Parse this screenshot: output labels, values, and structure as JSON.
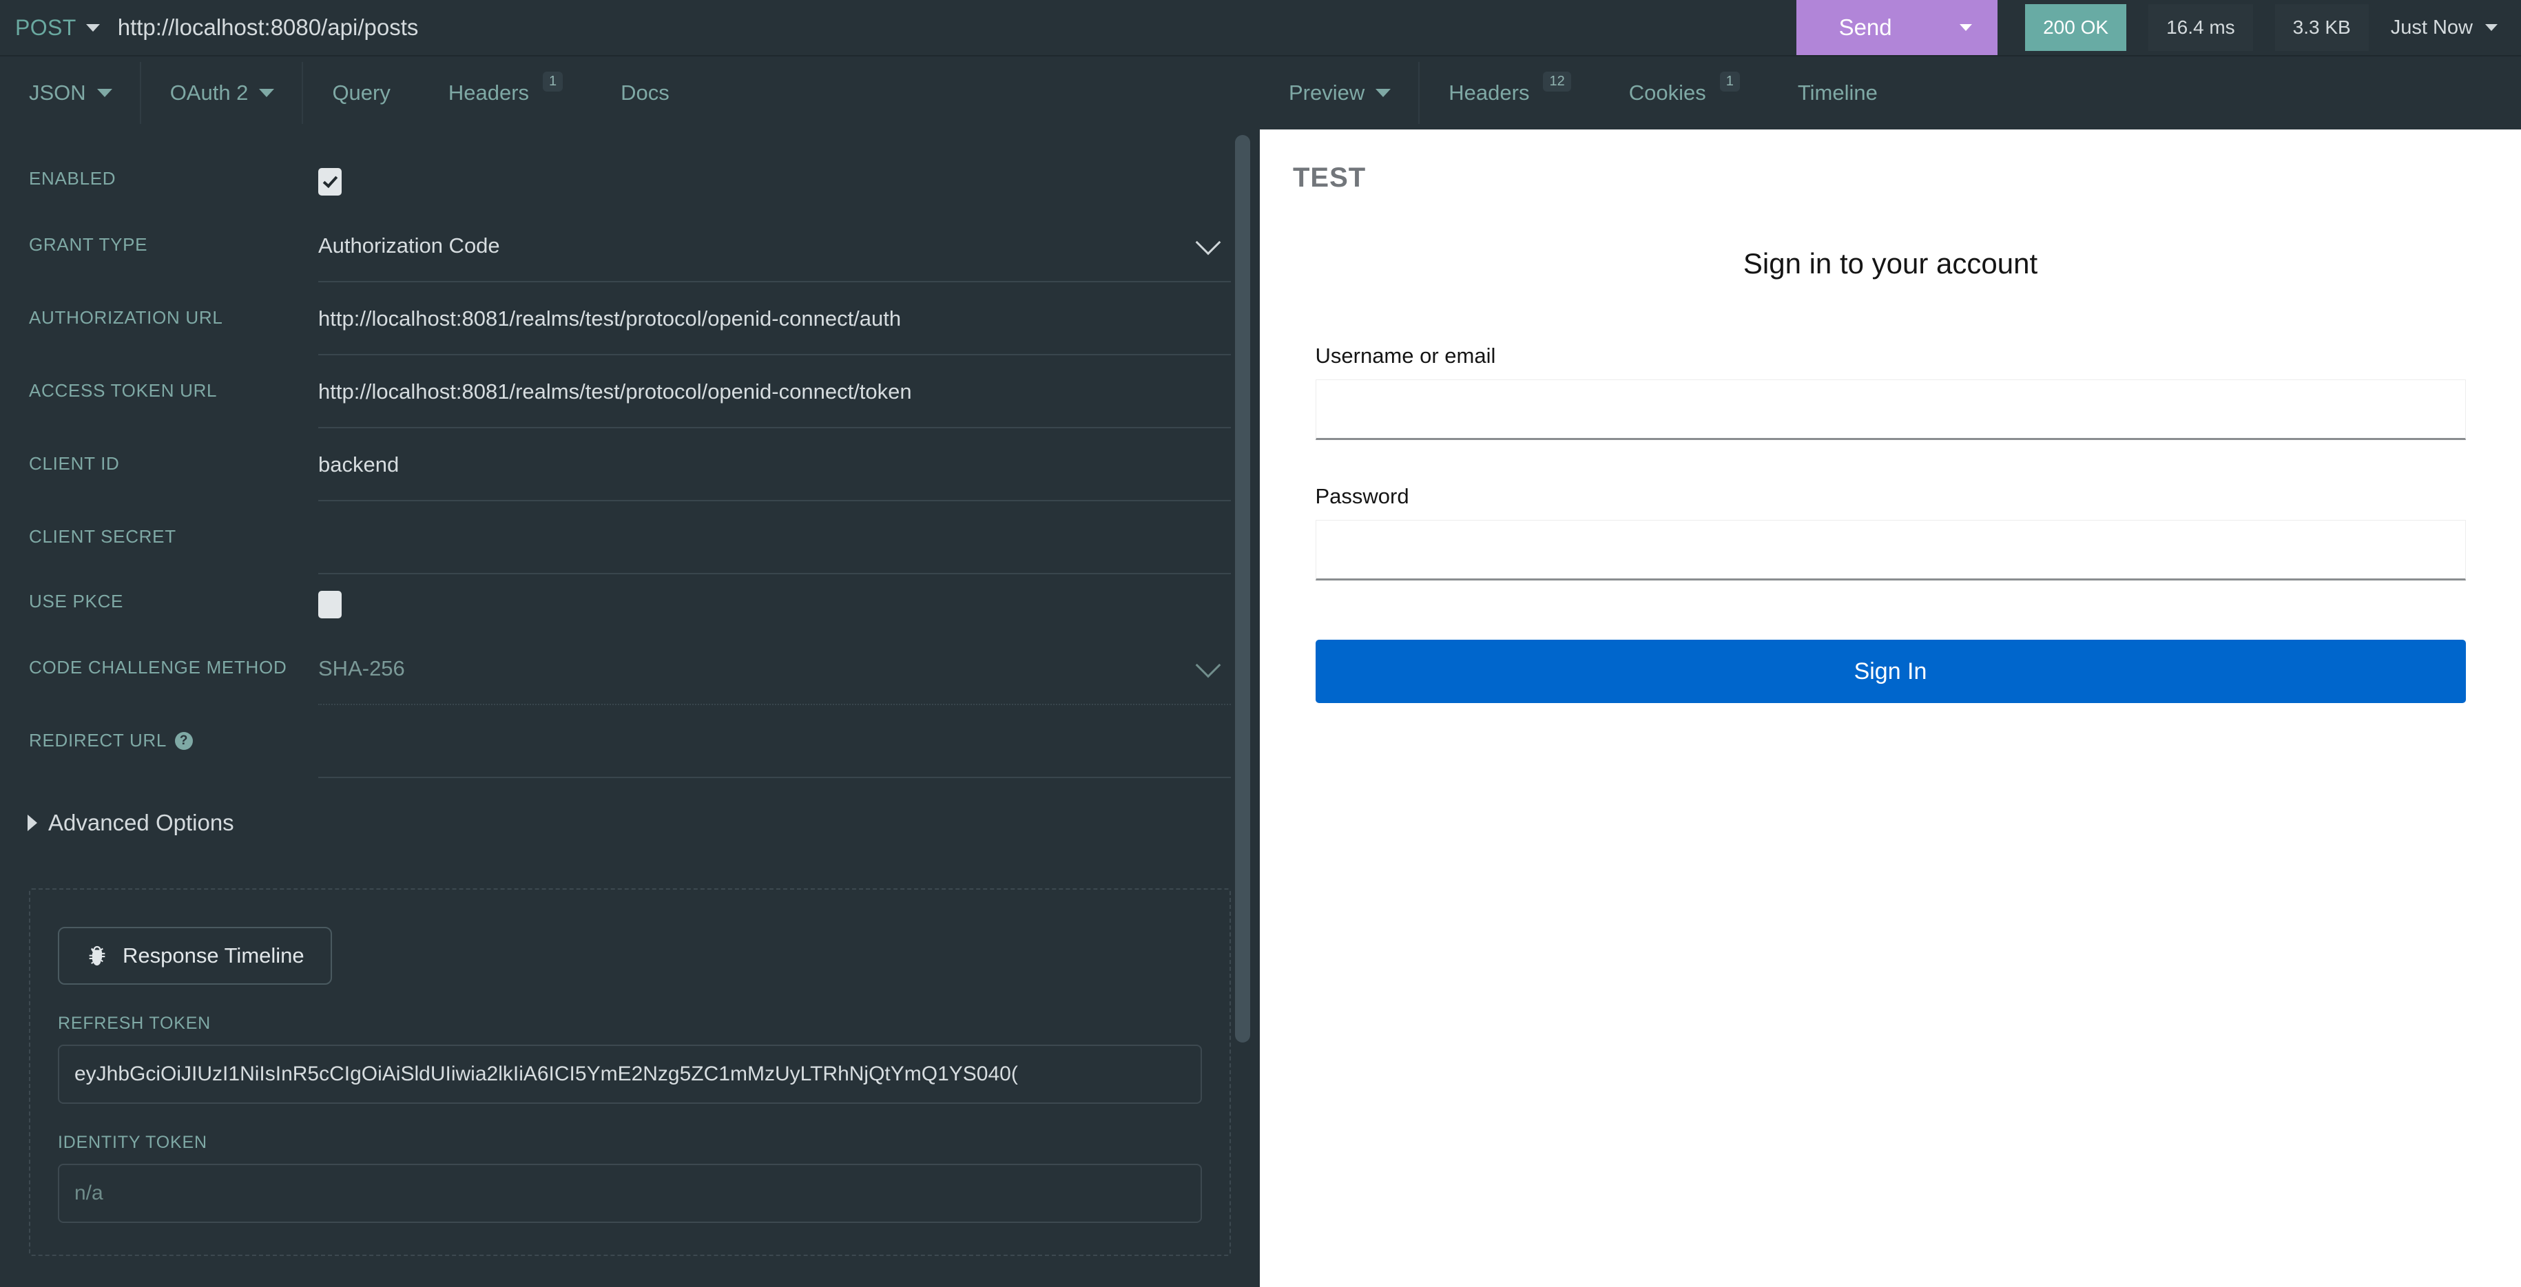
{
  "urlbar": {
    "method": "POST",
    "url": "http://localhost:8080/api/posts",
    "send_label": "Send",
    "status": "200 OK",
    "time": "16.4 ms",
    "size": "3.3 KB",
    "timestamp": "Just Now"
  },
  "request_tabs": [
    {
      "label": "JSON",
      "has_caret": true,
      "badge": ""
    },
    {
      "label": "OAuth 2",
      "has_caret": true,
      "badge": ""
    },
    {
      "label": "Query",
      "has_caret": false,
      "badge": ""
    },
    {
      "label": "Headers",
      "has_caret": false,
      "badge": "1"
    },
    {
      "label": "Docs",
      "has_caret": false,
      "badge": ""
    }
  ],
  "response_tabs": [
    {
      "label": "Preview",
      "has_caret": true,
      "badge": ""
    },
    {
      "label": "Headers",
      "has_caret": false,
      "badge": "12"
    },
    {
      "label": "Cookies",
      "has_caret": false,
      "badge": "1"
    },
    {
      "label": "Timeline",
      "has_caret": false,
      "badge": ""
    }
  ],
  "oauth": {
    "enabled_label": "ENABLED",
    "enabled_checked": true,
    "grant_type_label": "GRANT TYPE",
    "grant_type_value": "Authorization Code",
    "authorization_url_label": "AUTHORIZATION URL",
    "authorization_url_value": "http://localhost:8081/realms/test/protocol/openid-connect/auth",
    "access_token_url_label": "ACCESS TOKEN URL",
    "access_token_url_value": "http://localhost:8081/realms/test/protocol/openid-connect/token",
    "client_id_label": "CLIENT ID",
    "client_id_value": "backend",
    "client_secret_label": "CLIENT SECRET",
    "client_secret_value": "",
    "use_pkce_label": "USE PKCE",
    "use_pkce_checked": false,
    "code_challenge_method_label": "CODE CHALLENGE METHOD",
    "code_challenge_method_value": "SHA-256",
    "redirect_url_label": "REDIRECT URL",
    "redirect_url_value": "",
    "advanced_options_label": "Advanced Options"
  },
  "token_panel": {
    "timeline_button_label": "Response Timeline",
    "refresh_token_label": "REFRESH TOKEN",
    "refresh_token_value": "eyJhbGciOiJIUzI1NiIsInR5cCIgOiAiSldUIiwia2lkIiA6ICI5YmE2Nzg5ZC1mMzUyLTRhNjQtYmQ1YS040(",
    "identity_token_label": "IDENTITY TOKEN",
    "identity_token_value": "n/a"
  },
  "preview": {
    "brand": "TEST",
    "title": "Sign in to your account",
    "username_label": "Username or email",
    "username_value": "",
    "password_label": "Password",
    "password_value": "",
    "submit_label": "Sign In"
  },
  "colors": {
    "bg_dark": "#273238",
    "accent_send": "#b185d8",
    "accent_ok": "#68aba4",
    "teal_text": "#7fa9a5",
    "kc_blue": "#0066cc"
  }
}
